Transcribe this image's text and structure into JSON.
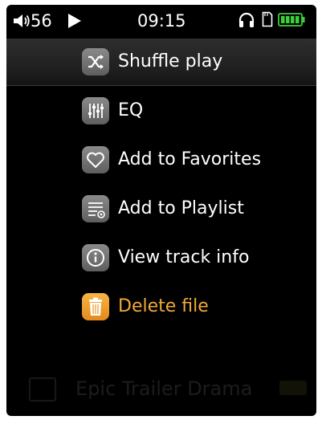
{
  "status_bar": {
    "volume": "56",
    "time": "09:15",
    "icons": [
      "speaker-icon",
      "play-icon",
      "headphones-icon",
      "sd-card-icon",
      "battery-icon"
    ],
    "battery_color": "#3ccf3c"
  },
  "menu": {
    "items": [
      {
        "label": "Shuffle play",
        "icon": "shuffle-icon",
        "selected": true
      },
      {
        "label": "EQ",
        "icon": "equalizer-icon"
      },
      {
        "label": "Add to Favorites",
        "icon": "heart-icon"
      },
      {
        "label": "Add to Playlist",
        "icon": "playlist-add-icon"
      },
      {
        "label": "View track info",
        "icon": "info-icon"
      },
      {
        "label": "Delete file",
        "icon": "trash-icon",
        "accent": "#f2a93b"
      }
    ]
  },
  "background_track": {
    "title": "Epic Trailer Drama"
  },
  "colors": {
    "background": "#000000",
    "icon_gray": "#6e6e6e",
    "accent_orange": "#f2a93b"
  }
}
